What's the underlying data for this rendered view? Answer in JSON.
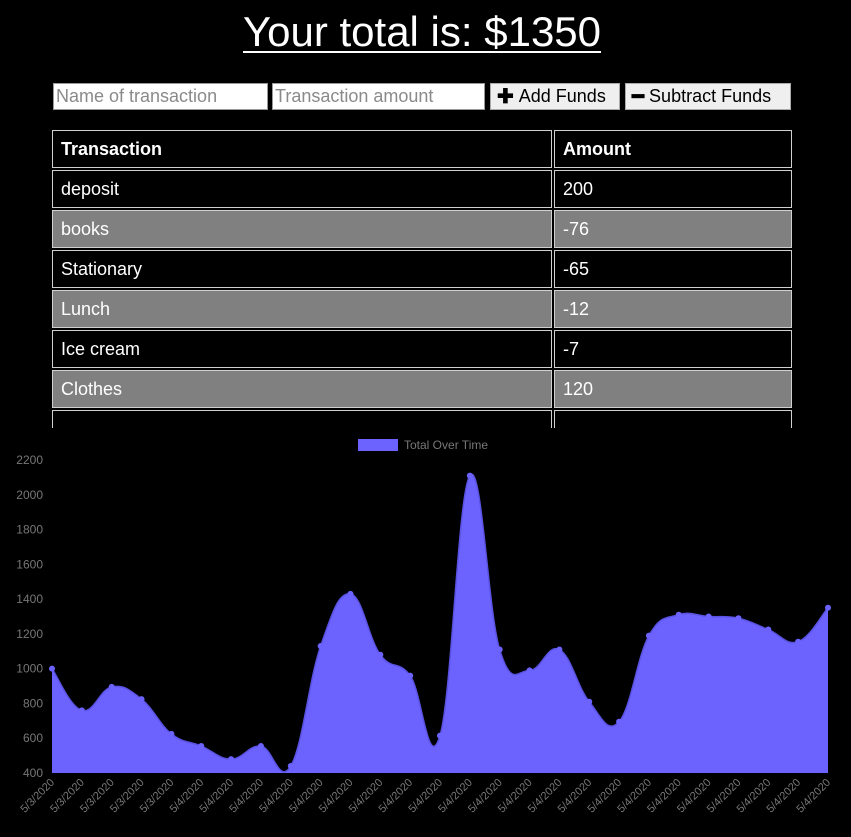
{
  "header": {
    "total_label": "Your total is: $1350"
  },
  "form": {
    "name_placeholder": "Name of transaction",
    "amount_placeholder": "Transaction amount",
    "add_icon": "✚",
    "add_label": "Add Funds",
    "subtract_icon": "━",
    "subtract_label": "Subtract Funds"
  },
  "table": {
    "headers": [
      "Transaction",
      "Amount"
    ],
    "rows": [
      {
        "name": "deposit",
        "amount": "200"
      },
      {
        "name": "books",
        "amount": "-76"
      },
      {
        "name": "Stationary",
        "amount": "-65"
      },
      {
        "name": "Lunch",
        "amount": "-12"
      },
      {
        "name": "Ice cream",
        "amount": "-7"
      },
      {
        "name": "Clothes",
        "amount": "120"
      },
      {
        "name": "",
        "amount": ""
      }
    ]
  },
  "chart_data": {
    "type": "area",
    "series": [
      {
        "name": "Total Over Time",
        "color": "#6c63ff",
        "values": [
          1000,
          760,
          895,
          825,
          625,
          555,
          480,
          555,
          440,
          1130,
          1430,
          1080,
          960,
          615,
          2110,
          1110,
          990,
          1110,
          810,
          695,
          1190,
          1310,
          1300,
          1290,
          1225,
          1155,
          1350
        ]
      }
    ],
    "categories": [
      "5/3/2020",
      "5/3/2020",
      "5/3/2020",
      "5/3/2020",
      "5/3/2020",
      "5/4/2020",
      "5/4/2020",
      "5/4/2020",
      "5/4/2020",
      "5/4/2020",
      "5/4/2020",
      "5/4/2020",
      "5/4/2020",
      "5/4/2020",
      "5/4/2020",
      "5/4/2020",
      "5/4/2020",
      "5/4/2020",
      "5/4/2020",
      "5/4/2020",
      "5/4/2020",
      "5/4/2020",
      "5/4/2020",
      "5/4/2020",
      "5/4/2020",
      "5/4/2020",
      "5/4/2020"
    ],
    "yticks": [
      "400",
      "600",
      "800",
      "1000",
      "1200",
      "1400",
      "1600",
      "1800",
      "2000",
      "2200"
    ],
    "ylim": [
      400,
      2200
    ],
    "legend_position": "top-center"
  }
}
